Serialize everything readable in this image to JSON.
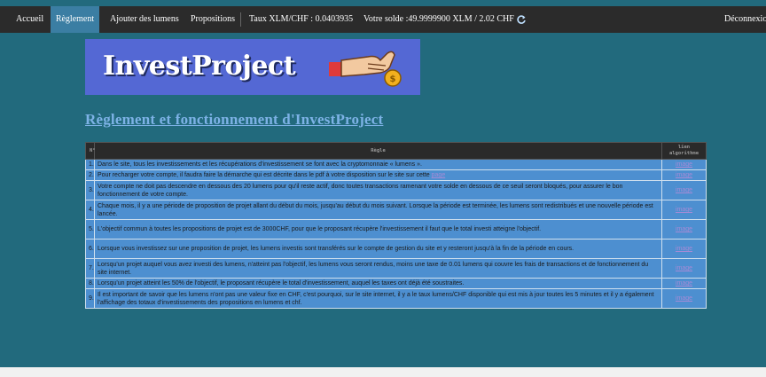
{
  "nav": {
    "home": "Accueil",
    "rules": "Règlement",
    "add_lumens": "Ajouter des lumens",
    "proposals": "Propositions",
    "rate": "Taux XLM/CHF : 0.0403935",
    "balance": "Votre solde :49.9999900 XLM / 2.02 CHF",
    "logout": "Déconnexion"
  },
  "logo": {
    "text": "InvestProject",
    "hand_icon": "hand-dropping-coin-icon"
  },
  "page_title": "Règlement et fonctionnement d'InvestProject",
  "table": {
    "headers": {
      "num": "N°",
      "rule": "Règle",
      "link": "lien algorithme"
    },
    "rows": [
      {
        "num": "1.",
        "text": "Dans le site, tous les investissements et les récupérations d'investissement se font avec la cryptomonnaie « lumens ».",
        "link": "image"
      },
      {
        "num": "2.",
        "text": "Pour recharger votre compte, il faudra faire la démarche qui est décrite dans le pdf à votre disposition sur le site sur cette ",
        "inline_link": "page",
        "link": "image"
      },
      {
        "num": "3.",
        "text": "Votre compte ne doit pas descendre en dessous des 20 lumens pour qu'il reste actif, donc toutes transactions ramenant votre solde en dessous de ce seuil seront bloqués, pour assurer le bon fonctionnement de votre compte.",
        "link": "image"
      },
      {
        "num": "4.",
        "text": "Chaque mois, il y a une période de proposition de projet allant du début du mois, jusqu'au début du mois suivant. Lorsque la période est terminée, les lumens sont redistribués et une nouvelle période est lancée.",
        "link": "image"
      },
      {
        "num": "5.",
        "text": "L'objectif commun à toutes les propositions de projet est de 3000CHF, pour que le proposant récupère l'investissement il faut que le total investi atteigne l'objectif.",
        "link": "image"
      },
      {
        "num": "6.",
        "text": "Lorsque vous investissez sur une proposition de projet, les lumens investis sont transférés sur le compte de gestion du site et y resteront jusqu'à la fin de la période en cours.",
        "link": "image"
      },
      {
        "num": "7.",
        "text": "Lorsqu'un projet auquel vous avez investi des lumens, n'atteint pas l'objectif, les lumens vous seront rendus, moins une taxe de 0.01 lumens qui couvre les frais de transactions et de fonctionnement du site internet.",
        "link": "image"
      },
      {
        "num": "8.",
        "text": "Lorsqu'un projet atteint les 50% de l'objectif, le proposant récupère le total d'investissement, auquel les taxes ont déjà été soustraites.",
        "link": "image"
      },
      {
        "num": "9.",
        "text": "Il est important de savoir que les lumens n'ont pas une valeur fixe en CHF, c'est pourquoi, sur le site internet, il y a le taux lumens/CHF disponible qui est mis à jour toutes les 5 minutes et il y a également l'affichage des totaux d'investissements des propositions en lumens et chf.",
        "link": "image"
      }
    ]
  },
  "colors": {
    "background": "#226a7d",
    "navbar": "#2b2b2b",
    "active_tab": "#3b7ea3",
    "row": "#4d8fd0",
    "title": "#7db2e6"
  }
}
